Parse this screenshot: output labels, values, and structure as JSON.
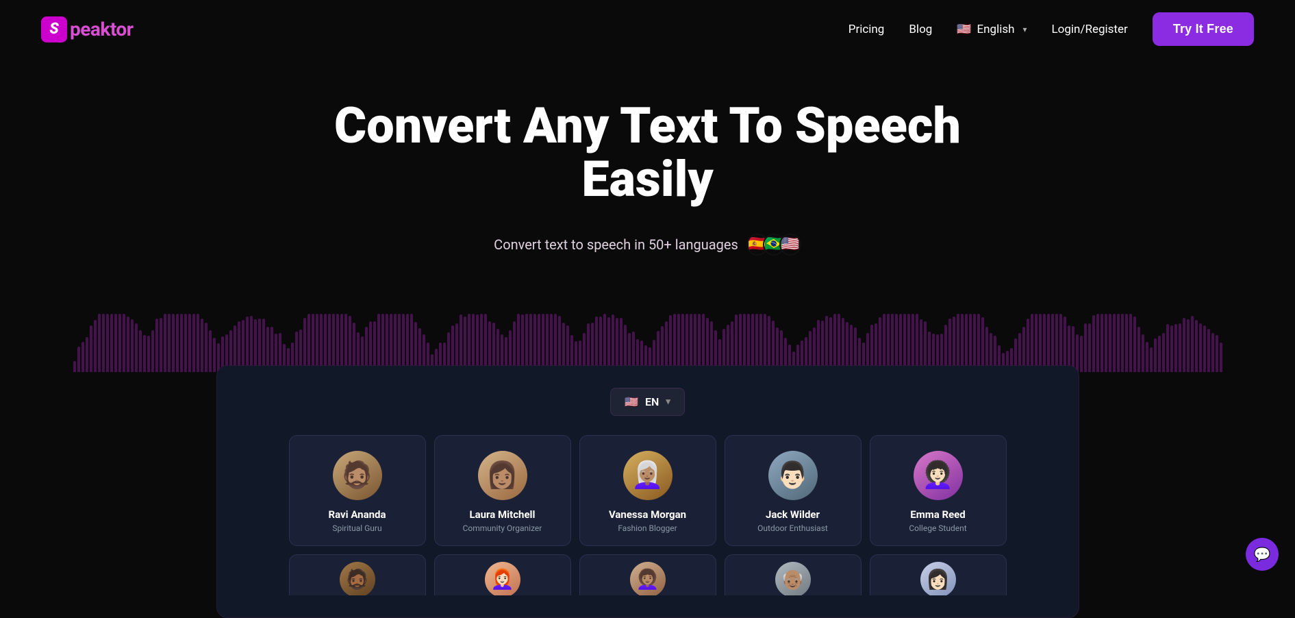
{
  "nav": {
    "logo_letter": "S",
    "logo_text": "peaktor",
    "links": [
      {
        "id": "pricing",
        "label": "Pricing"
      },
      {
        "id": "blog",
        "label": "Blog"
      }
    ],
    "language": {
      "flag": "🇺🇸",
      "label": "English",
      "chevron": "▾"
    },
    "login_label": "Login/Register",
    "cta_label": "Try It Free"
  },
  "hero": {
    "title": "Convert Any Text To Speech Easily",
    "subtitle": "Convert text to speech in 50+ languages",
    "flags": [
      "🇪🇸",
      "🇧🇷",
      "🇺🇸"
    ]
  },
  "panel": {
    "lang_selector": {
      "flag": "🇺🇸",
      "code": "EN",
      "chevron": "▾"
    },
    "voice_cards": [
      {
        "id": "ravi",
        "name": "Ravi Ananda",
        "role": "Spiritual Guru",
        "emoji": "🧔"
      },
      {
        "id": "laura",
        "name": "Laura Mitchell",
        "role": "Community Organizer",
        "emoji": "👩"
      },
      {
        "id": "vanessa",
        "name": "Vanessa Morgan",
        "role": "Fashion Blogger",
        "emoji": "👩‍🦳"
      },
      {
        "id": "jack",
        "name": "Jack Wilder",
        "role": "Outdoor Enthusiast",
        "emoji": "👨"
      },
      {
        "id": "emma",
        "name": "Emma Reed",
        "role": "College Student",
        "emoji": "👩‍🦱"
      }
    ],
    "bottom_cards": [
      {
        "id": "b1",
        "emoji": "👨‍🦳"
      },
      {
        "id": "b2",
        "emoji": "👩‍🦰"
      },
      {
        "id": "b3",
        "emoji": "👩‍🦱"
      },
      {
        "id": "b4",
        "emoji": "👴"
      },
      {
        "id": "b5",
        "emoji": "👩"
      }
    ]
  },
  "chat_button": {
    "icon": "💬"
  }
}
